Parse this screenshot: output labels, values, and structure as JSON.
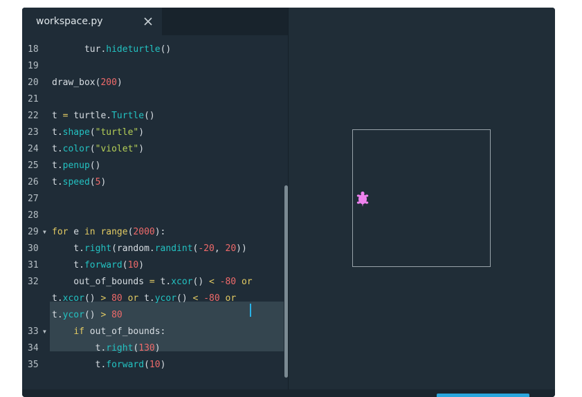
{
  "tab": {
    "label": "workspace.py",
    "close_icon": "close-icon"
  },
  "colors": {
    "keyword": "#e2ca63",
    "function": "#23c2c2",
    "number": "#ef6a6a",
    "string": "#b5cf57",
    "turtle": "#ee82ee",
    "run_button": "#2aa6dd"
  },
  "editor": {
    "lines": [
      {
        "num": "18",
        "tokens": [
          [
            "      tur.",
            ""
          ],
          [
            "hideturtle",
            "f"
          ],
          [
            "()",
            ""
          ]
        ]
      },
      {
        "num": "19",
        "tokens": []
      },
      {
        "num": "20",
        "tokens": [
          [
            "draw_box(",
            ""
          ],
          [
            "200",
            "n"
          ],
          [
            ")",
            ""
          ]
        ]
      },
      {
        "num": "21",
        "tokens": []
      },
      {
        "num": "22",
        "tokens": [
          [
            "t ",
            ""
          ],
          [
            "=",
            "k"
          ],
          [
            " turtle.",
            ""
          ],
          [
            "Turtle",
            "f"
          ],
          [
            "()",
            ""
          ]
        ]
      },
      {
        "num": "23",
        "tokens": [
          [
            "t.",
            ""
          ],
          [
            "shape",
            "f"
          ],
          [
            "(",
            ""
          ],
          [
            "\"turtle\"",
            "s"
          ],
          [
            ")",
            ""
          ]
        ]
      },
      {
        "num": "24",
        "tokens": [
          [
            "t.",
            ""
          ],
          [
            "color",
            "f"
          ],
          [
            "(",
            ""
          ],
          [
            "\"violet\"",
            "s"
          ],
          [
            ")",
            ""
          ]
        ]
      },
      {
        "num": "25",
        "tokens": [
          [
            "t.",
            ""
          ],
          [
            "penup",
            "f"
          ],
          [
            "()",
            ""
          ]
        ]
      },
      {
        "num": "26",
        "tokens": [
          [
            "t.",
            ""
          ],
          [
            "speed",
            "f"
          ],
          [
            "(",
            ""
          ],
          [
            "5",
            "n"
          ],
          [
            ")",
            ""
          ]
        ]
      },
      {
        "num": "27",
        "tokens": []
      },
      {
        "num": "28",
        "tokens": []
      },
      {
        "num": "29",
        "fold": true,
        "tokens": [
          [
            "for",
            "k"
          ],
          [
            " e ",
            ""
          ],
          [
            "in",
            "k"
          ],
          [
            " ",
            ""
          ],
          [
            "range",
            "k"
          ],
          [
            "(",
            ""
          ],
          [
            "2000",
            "n"
          ],
          [
            "):",
            ""
          ]
        ]
      },
      {
        "num": "30",
        "tokens": [
          [
            "    t.",
            ""
          ],
          [
            "right",
            "f"
          ],
          [
            "(random.",
            ""
          ],
          [
            "randint",
            "f"
          ],
          [
            "(",
            ""
          ],
          [
            "-20",
            "n"
          ],
          [
            ", ",
            ""
          ],
          [
            "20",
            "n"
          ],
          [
            "))",
            ""
          ]
        ]
      },
      {
        "num": "31",
        "tokens": [
          [
            "    t.",
            ""
          ],
          [
            "forward",
            "f"
          ],
          [
            "(",
            ""
          ],
          [
            "10",
            "n"
          ],
          [
            ")",
            ""
          ]
        ]
      },
      {
        "num": "32",
        "tokens": [
          [
            "    out_of_bounds ",
            ""
          ],
          [
            "=",
            "k"
          ],
          [
            " t.",
            ""
          ],
          [
            "xcor",
            "f"
          ],
          [
            "() ",
            ""
          ],
          [
            "<",
            "k"
          ],
          [
            " ",
            ""
          ],
          [
            "-80",
            "n"
          ],
          [
            " ",
            ""
          ],
          [
            "or",
            "k"
          ]
        ]
      },
      {
        "num": "",
        "tokens": [
          [
            "t.",
            ""
          ],
          [
            "xcor",
            "f"
          ],
          [
            "() ",
            ""
          ],
          [
            ">",
            "k"
          ],
          [
            " ",
            ""
          ],
          [
            "80",
            "n"
          ],
          [
            " ",
            ""
          ],
          [
            "or",
            "k"
          ],
          [
            " t.",
            ""
          ],
          [
            "ycor",
            "f"
          ],
          [
            "() ",
            ""
          ],
          [
            "<",
            "k"
          ],
          [
            " ",
            ""
          ],
          [
            "-80",
            "n"
          ],
          [
            " ",
            ""
          ],
          [
            "or",
            "k"
          ]
        ]
      },
      {
        "num": "",
        "tokens": [
          [
            "t.",
            ""
          ],
          [
            "ycor",
            "f"
          ],
          [
            "() ",
            ""
          ],
          [
            ">",
            "k"
          ],
          [
            " ",
            ""
          ],
          [
            "80",
            "n"
          ]
        ]
      },
      {
        "num": "33",
        "fold": true,
        "tokens": [
          [
            "    ",
            ""
          ],
          [
            "if",
            "k"
          ],
          [
            " out_of_bounds:",
            ""
          ]
        ]
      },
      {
        "num": "34",
        "tokens": [
          [
            "        t.",
            ""
          ],
          [
            "right",
            "f"
          ],
          [
            "(",
            ""
          ],
          [
            "130",
            "n"
          ],
          [
            ")",
            ""
          ]
        ]
      },
      {
        "num": "35",
        "tokens": [
          [
            "        t.",
            ""
          ],
          [
            "forward",
            "f"
          ],
          [
            "(",
            ""
          ],
          [
            "10",
            "n"
          ],
          [
            ")",
            ""
          ]
        ]
      }
    ]
  }
}
